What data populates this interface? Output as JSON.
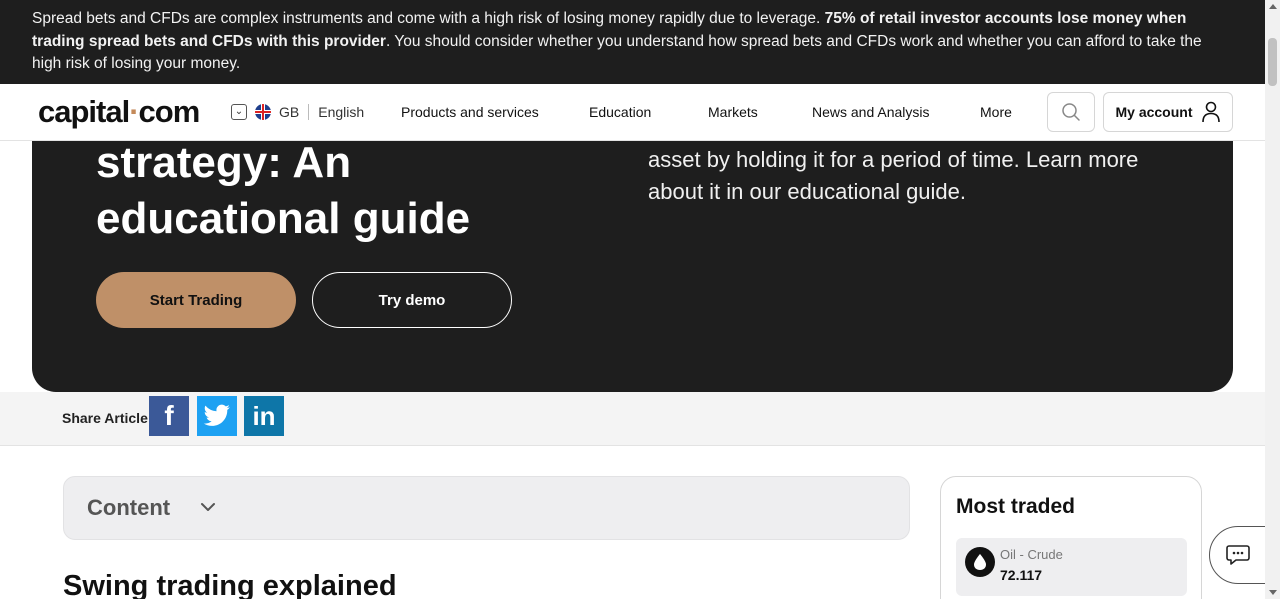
{
  "risk_banner": {
    "text_start": "Spread bets and CFDs are complex instruments and come with a high risk of losing money rapidly due to leverage. ",
    "text_bold": "75% of retail investor accounts lose money when trading spread bets and CFDs with this provider",
    "text_end": ". You should consider whether you understand how spread bets and CFDs work and whether you can afford to take the high risk of losing your money."
  },
  "header": {
    "logo_left": "capital",
    "logo_dot": "·",
    "logo_right": "com",
    "locale": {
      "region": "GB",
      "language": "English",
      "flag_icon": "uk-flag-icon"
    },
    "nav": [
      "Products and services",
      "Education",
      "Markets",
      "News and Analysis",
      "More"
    ],
    "account_label": "My account"
  },
  "hero": {
    "title": "strategy: An educational guide",
    "description": "asset by holding it for a period of time. Learn more about it in our educational guide.",
    "primary_button": "Start Trading",
    "secondary_button": "Try demo",
    "accent_color": "#bf9068"
  },
  "share": {
    "label": "Share Article",
    "networks": [
      {
        "name": "Facebook",
        "glyph": "f",
        "color": "#3b5998"
      },
      {
        "name": "Twitter",
        "glyph": "t",
        "color": "#1da1f2"
      },
      {
        "name": "LinkedIn",
        "glyph": "in",
        "color": "#0e76a8"
      }
    ]
  },
  "content": {
    "toc_label": "Content",
    "heading": "Swing trading explained"
  },
  "most_traded": {
    "title": "Most traded",
    "items": [
      {
        "name": "Oil - Crude",
        "price": "72.117",
        "icon": "oil-drop-icon"
      }
    ]
  }
}
